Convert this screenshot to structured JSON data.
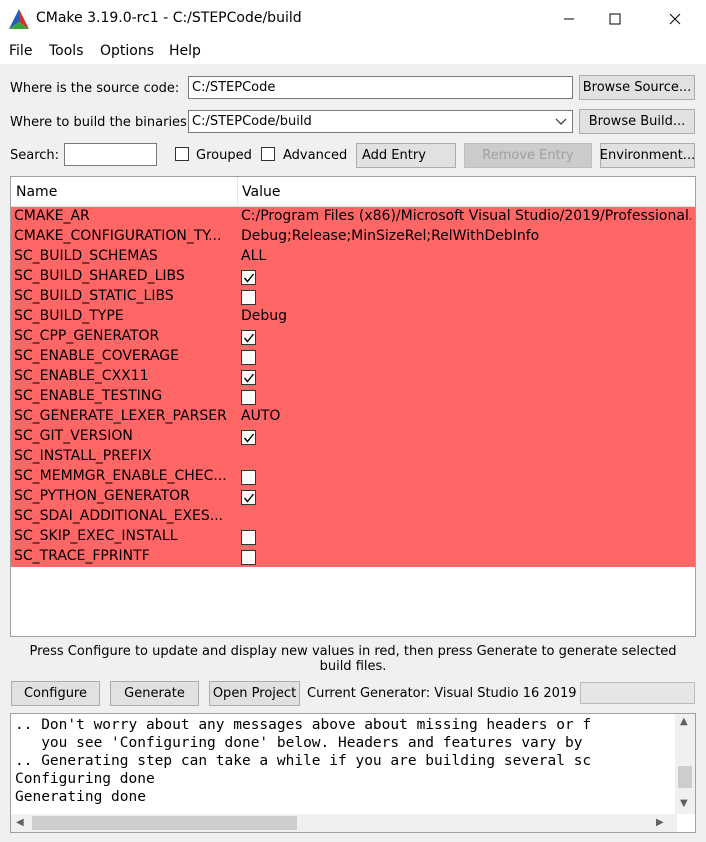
{
  "window": {
    "title": "CMake 3.19.0-rc1 - C:/STEPCode/build"
  },
  "menu": [
    "File",
    "Tools",
    "Options",
    "Help"
  ],
  "source": {
    "label": "Where is the source code:",
    "value": "C:/STEPCode",
    "browse_label": "Browse Source..."
  },
  "build": {
    "label": "Where to build the binaries:",
    "value": "C:/STEPCode/build",
    "browse_label": "Browse Build..."
  },
  "search": {
    "label": "Search:",
    "value": ""
  },
  "options": {
    "grouped_label": "Grouped",
    "advanced_label": "Advanced",
    "grouped": false,
    "advanced": false
  },
  "buttons": {
    "add_entry": "Add Entry",
    "remove_entry": "Remove Entry",
    "environment": "Environment..."
  },
  "table": {
    "headers": {
      "name": "Name",
      "value": "Value"
    },
    "row_color": "#ff6666",
    "rows": [
      {
        "name": "CMAKE_AR",
        "type": "text",
        "value": "C:/Program Files (x86)/Microsoft Visual Studio/2019/Professional..."
      },
      {
        "name": "CMAKE_CONFIGURATION_TY...",
        "type": "text",
        "value": "Debug;Release;MinSizeRel;RelWithDebInfo"
      },
      {
        "name": "SC_BUILD_SCHEMAS",
        "type": "text",
        "value": "ALL"
      },
      {
        "name": "SC_BUILD_SHARED_LIBS",
        "type": "bool",
        "checked": true
      },
      {
        "name": "SC_BUILD_STATIC_LIBS",
        "type": "bool",
        "checked": false
      },
      {
        "name": "SC_BUILD_TYPE",
        "type": "text",
        "value": "Debug"
      },
      {
        "name": "SC_CPP_GENERATOR",
        "type": "bool",
        "checked": true
      },
      {
        "name": "SC_ENABLE_COVERAGE",
        "type": "bool",
        "checked": false
      },
      {
        "name": "SC_ENABLE_CXX11",
        "type": "bool",
        "checked": true
      },
      {
        "name": "SC_ENABLE_TESTING",
        "type": "bool",
        "checked": false
      },
      {
        "name": "SC_GENERATE_LEXER_PARSER",
        "type": "text",
        "value": "AUTO"
      },
      {
        "name": "SC_GIT_VERSION",
        "type": "bool",
        "checked": true
      },
      {
        "name": "SC_INSTALL_PREFIX",
        "type": "text",
        "value": ""
      },
      {
        "name": "SC_MEMMGR_ENABLE_CHEC...",
        "type": "bool",
        "checked": false
      },
      {
        "name": "SC_PYTHON_GENERATOR",
        "type": "bool",
        "checked": true
      },
      {
        "name": "SC_SDAI_ADDITIONAL_EXES...",
        "type": "text",
        "value": ""
      },
      {
        "name": "SC_SKIP_EXEC_INSTALL",
        "type": "bool",
        "checked": false
      },
      {
        "name": "SC_TRACE_FPRINTF",
        "type": "bool",
        "checked": false
      }
    ]
  },
  "hint": "Press Configure to update and display new values in red, then press Generate to generate selected build files.",
  "actions": {
    "configure": "Configure",
    "generate": "Generate",
    "open_project": "Open Project",
    "current_generator": "Current Generator: Visual Studio 16 2019"
  },
  "output": [
    ".. Don't worry about any messages above about missing headers or f",
    "   you see 'Configuring done' below. Headers and features vary by",
    ".. Generating step can take a while if you are building several sc",
    "Configuring done",
    "Generating done"
  ]
}
